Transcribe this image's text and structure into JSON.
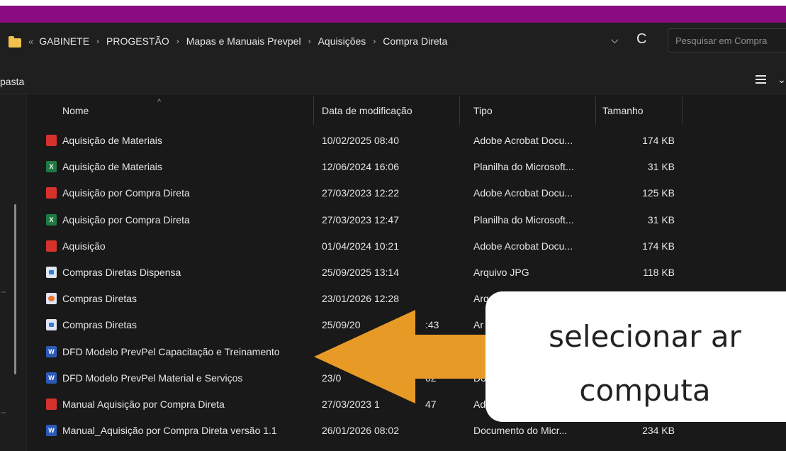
{
  "address_bar": {
    "overflow_chevrons": "«",
    "crumbs": [
      "GABINETE",
      "PROGESTÃO",
      "Mapas e Manuais Prevpel",
      "Aquisições",
      "Compra Direta"
    ],
    "separator": "›",
    "dropdown_glyph": "⌵",
    "refresh_glyph": "C",
    "search_placeholder": "Pesquisar em Compra"
  },
  "toolbar": {
    "left_label": "pasta",
    "view_chevron": "⌄"
  },
  "columns": {
    "name": "Nome",
    "date": "Data de modificação",
    "type": "Tipo",
    "size": "Tamanho",
    "sort_caret": "^"
  },
  "files": [
    {
      "name": "Aquisição de Materiais",
      "date": "10/02/2025 08:40",
      "type": "Adobe Acrobat Docu...",
      "size": "174 KB",
      "icon": "pdf-icon",
      "icon_label": ""
    },
    {
      "name": "Aquisição de Materiais",
      "date": "12/06/2024 16:06",
      "type": "Planilha do Microsoft...",
      "size": "31 KB",
      "icon": "excel-icon",
      "icon_label": "X"
    },
    {
      "name": "Aquisição por Compra Direta",
      "date": "27/03/2023 12:22",
      "type": "Adobe Acrobat Docu...",
      "size": "125 KB",
      "icon": "pdf-icon",
      "icon_label": ""
    },
    {
      "name": "Aquisição por Compra Direta",
      "date": "27/03/2023 12:47",
      "type": "Planilha do Microsoft...",
      "size": "31 KB",
      "icon": "excel-icon",
      "icon_label": "X"
    },
    {
      "name": "Aquisição",
      "date": "01/04/2024 10:21",
      "type": "Adobe Acrobat Docu...",
      "size": "174 KB",
      "icon": "pdf-icon",
      "icon_label": ""
    },
    {
      "name": "Compras Diretas Dispensa",
      "date": "25/09/2025 13:14",
      "type": "Arquivo JPG",
      "size": "118 KB",
      "icon": "jpg-image-icon",
      "icon_label": ""
    },
    {
      "name": "Compras Diretas",
      "date": "23/01/2026 12:28",
      "type": "Arq",
      "size": "",
      "icon": "png-image-icon",
      "icon_label": ""
    },
    {
      "name": "Compras Diretas",
      "date": "25/09/20",
      "date_tail": ":43",
      "type": "Ar",
      "size": "",
      "icon": "jpg-image-icon",
      "icon_label": ""
    },
    {
      "name": "DFD Modelo PrevPel Capacitação e Treinamento",
      "date": "",
      "type": "",
      "size": "",
      "icon": "word-icon",
      "icon_label": "W"
    },
    {
      "name": "DFD Modelo PrevPel Material e Serviços",
      "date": "23/0",
      "date_tail": "02",
      "type": "Do",
      "size": "",
      "icon": "word-icon",
      "icon_label": "W"
    },
    {
      "name": "Manual Aquisição por Compra Direta",
      "date": "27/03/2023 1",
      "date_tail": "47",
      "type": "Ad",
      "size": "",
      "icon": "pdf-icon",
      "icon_label": ""
    },
    {
      "name": "Manual_Aquisição por Compra Direta versão 1.1",
      "date": "26/01/2026 08:02",
      "type": "Documento do Micr...",
      "size": "234 KB",
      "icon": "word-icon",
      "icon_label": "W"
    }
  ],
  "callout": {
    "line1": "selecionar ar",
    "line2": "computa"
  },
  "colors": {
    "title_band": "#8b0c82",
    "arrow": "#e89a26",
    "background": "#191919"
  }
}
